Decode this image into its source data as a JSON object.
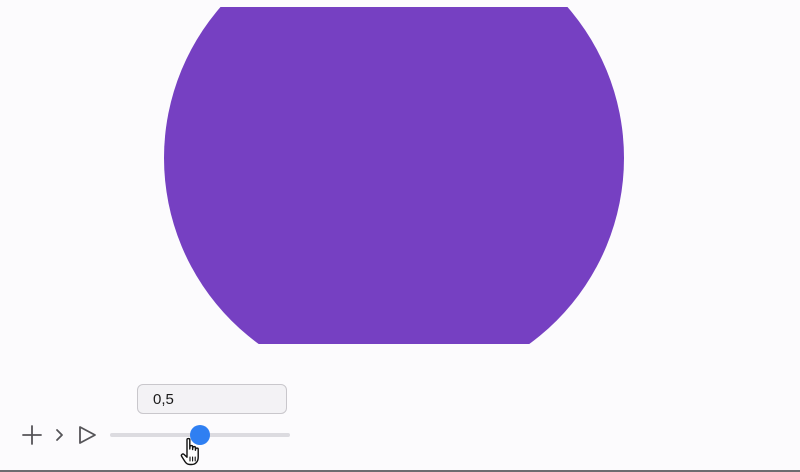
{
  "shape": {
    "fill": "#7640c2",
    "kind": "clipped-circle"
  },
  "controls": {
    "add_icon": "plus-icon",
    "step_icon": "chevron-right-icon",
    "play_icon": "play-icon",
    "icon_color": "#555458"
  },
  "slider": {
    "value_label": "0,5",
    "fraction": 0.5,
    "accent": "#2f7ff2"
  },
  "cursor": {
    "icon": "hand-pointer-icon"
  }
}
